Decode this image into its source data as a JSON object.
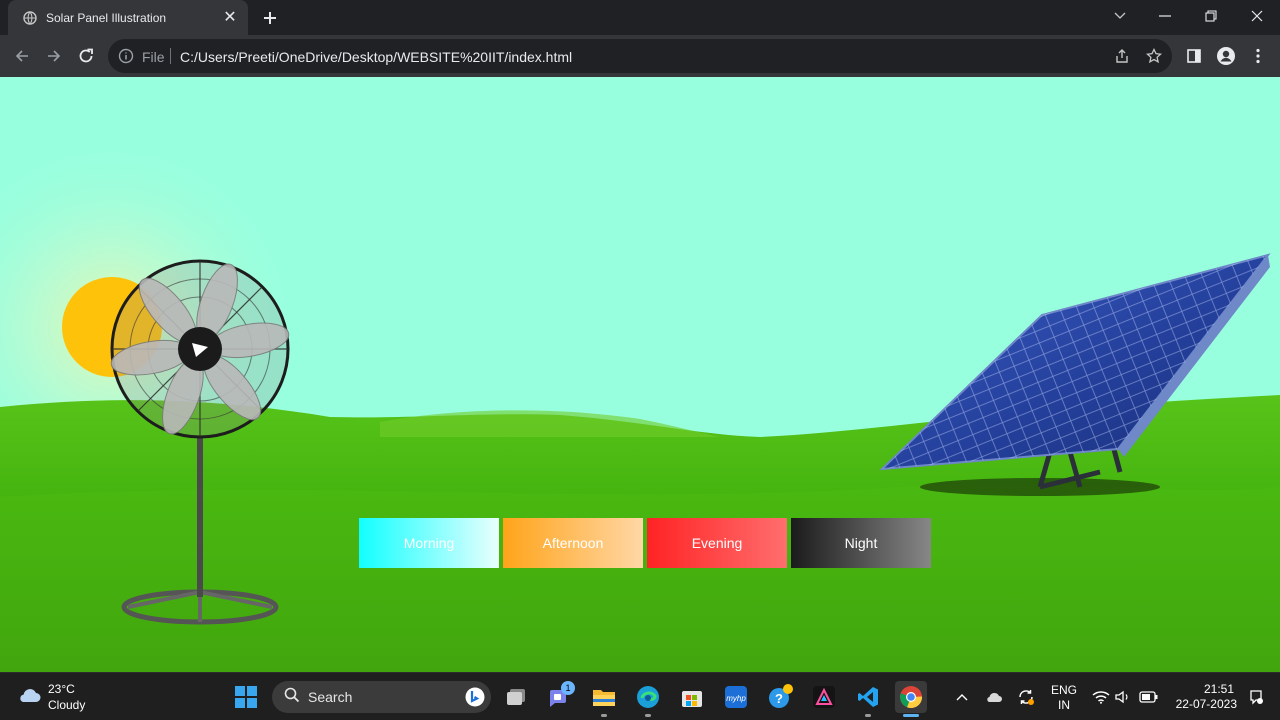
{
  "browser": {
    "tab_title": "Solar Panel Illustration",
    "address_scheme": "File",
    "address_url": "C:/Users/Preeti/OneDrive/Desktop/WEBSITE%20IIT/index.html"
  },
  "page": {
    "sky_color": "#98ffde",
    "sun_color": "#ffc20a",
    "grass_color": "#4bbf12",
    "mode_buttons": [
      "Morning",
      "Afternoon",
      "Evening",
      "Night"
    ]
  },
  "taskbar": {
    "weather_temp": "23°C",
    "weather_desc": "Cloudy",
    "search_label": "Search",
    "teams_badge": "1",
    "lang_line1": "ENG",
    "lang_line2": "IN",
    "time": "21:51",
    "date": "22-07-2023"
  }
}
